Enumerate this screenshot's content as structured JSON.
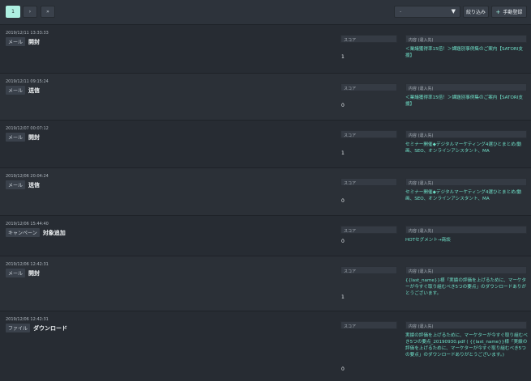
{
  "pagination": {
    "current": "1",
    "next": "›",
    "last": "»"
  },
  "toolbar": {
    "select_value": "-",
    "filter_label": "絞り込み",
    "add_label": "手動登録"
  },
  "labels": {
    "score": "スコア",
    "content": "内容 (違入先)"
  },
  "rows": [
    {
      "ts": "2019/12/11 13:33:33",
      "tag": "メール",
      "action": "開封",
      "score": "1",
      "content": "＜業議獲得率15倍！＞課題別事例集のご案内【SATORI支援】"
    },
    {
      "ts": "2019/12/11 09:15:24",
      "tag": "メール",
      "action": "送信",
      "score": "0",
      "content": "＜業議獲得率15倍！＞課題別事例集のご案内【SATORI支援】"
    },
    {
      "ts": "2019/12/07 00:07:12",
      "tag": "メール",
      "action": "開封",
      "score": "1",
      "content": "セミナー開催◆デジタルマーケティング4選ひとまとめ/動画、SEO、オンラインアシスタント、MA"
    },
    {
      "ts": "2019/12/06 20:04:24",
      "tag": "メール",
      "action": "送信",
      "score": "0",
      "content": "セミナー開催◆デジタルマーケティング4選ひとまとめ/動画、SEO、オンラインアシスタント、MA"
    },
    {
      "ts": "2019/12/06 15:44:40",
      "tag": "キャンペーン",
      "action": "対象追加",
      "score": "0",
      "content": "HOTセグメント→商談"
    },
    {
      "ts": "2019/12/06 12:42:31",
      "tag": "メール",
      "action": "開封",
      "score": "1",
      "content": "{{last_name}}様「実績の評価を上げるために、マーケターが今すぐ取り組むべき5つの要点」のダウンロードありがとうございます。"
    },
    {
      "ts": "2019/12/06 12:42:31",
      "tag": "ファイル",
      "action": "ダウンロード",
      "score": "0",
      "content": "実績の評価を上げるために、マーケターが今すぐ取り組むべき5つの要点_20190930.pdf ( {{last_name}}様「実績の評価を上げるために、マーケターが今すぐ取り組むべき5つの要点」のダウンロードありがとうございます。)"
    }
  ]
}
